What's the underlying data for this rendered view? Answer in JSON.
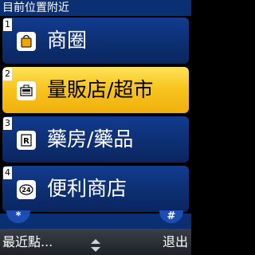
{
  "title": "目前位置附近",
  "items": [
    {
      "num": "1",
      "label": "商圈",
      "icon": "shopping-bag-icon"
    },
    {
      "num": "2",
      "label": "量販店/超市",
      "icon": "cash-register-icon",
      "selected": true
    },
    {
      "num": "3",
      "label": "藥房/藥品",
      "icon": "pharmacy-icon"
    },
    {
      "num": "4",
      "label": "便利商店",
      "icon": "convenience-store-icon"
    }
  ],
  "softkeys": {
    "star": "*",
    "hash": "#",
    "left": "最近點...",
    "right": "退出",
    "center_icon": "up-down-arrows-icon"
  },
  "colors": {
    "accent": "#f7c31a",
    "item_bg": "#0d2f72",
    "title_bg": "#0b2f73"
  }
}
